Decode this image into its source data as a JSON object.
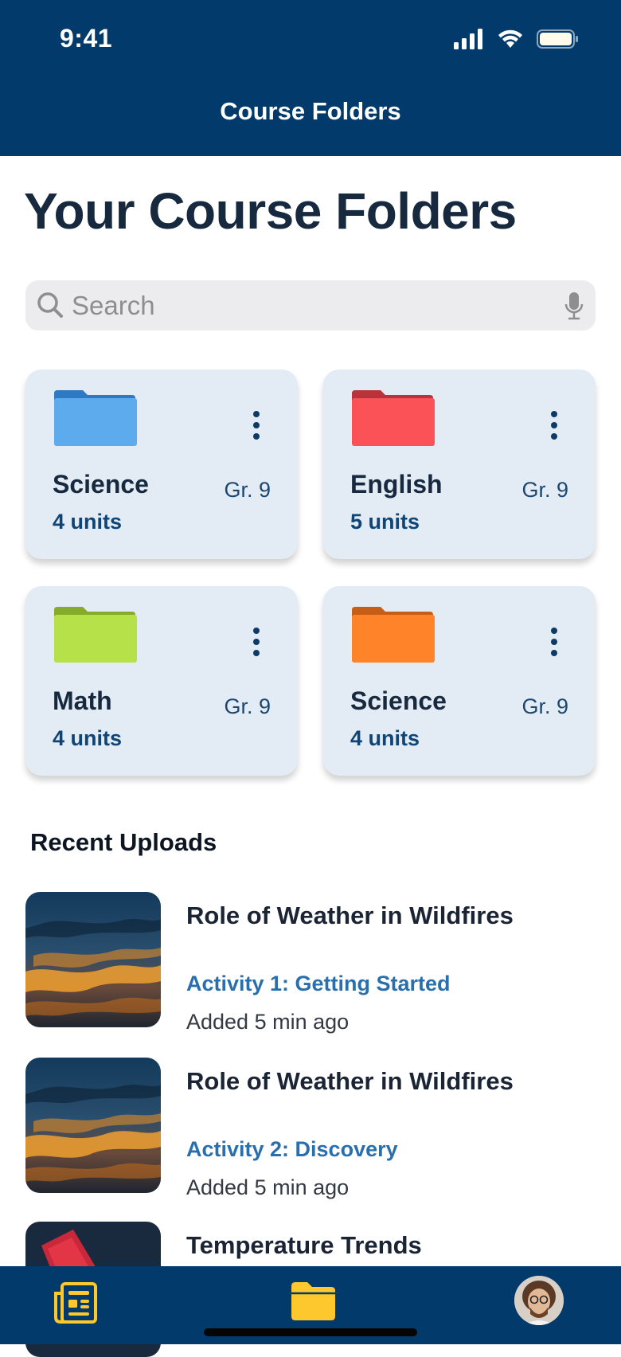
{
  "status_bar": {
    "time": "9:41"
  },
  "nav": {
    "title": "Course Folders"
  },
  "page": {
    "title": "Your Course Folders"
  },
  "search": {
    "placeholder": "Search",
    "value": ""
  },
  "folders": [
    {
      "name": "Science",
      "units": "4 units",
      "grade": "Gr. 9",
      "color": "#5dabed"
    },
    {
      "name": "English",
      "units": "5 units",
      "grade": "Gr. 9",
      "color": "#fa5257"
    },
    {
      "name": "Math",
      "units": "4 units",
      "grade": "Gr. 9",
      "color": "#b6e149"
    },
    {
      "name": "Science",
      "units": "4 units",
      "grade": "Gr. 9",
      "color": "#fe8329"
    }
  ],
  "recent": {
    "title": "Recent Uploads",
    "items": [
      {
        "title": "Role of Weather in Wildfires",
        "activity": "Activity 1: Getting Started",
        "added": "Added 5 min ago"
      },
      {
        "title": "Role of Weather in Wildfires",
        "activity": "Activity 2: Discovery",
        "added": "Added 5 min ago"
      },
      {
        "title": "Temperature Trends",
        "activity": "",
        "added": ""
      }
    ]
  },
  "tabbar": {
    "items": [
      {
        "icon": "news-icon"
      },
      {
        "icon": "folder-icon",
        "selected": true
      },
      {
        "icon": "avatar"
      }
    ],
    "accent": "#fdc82e"
  },
  "colors": {
    "primary": "#013a6b",
    "card_bg": "#e3ecf4",
    "link": "#2a6fad"
  }
}
